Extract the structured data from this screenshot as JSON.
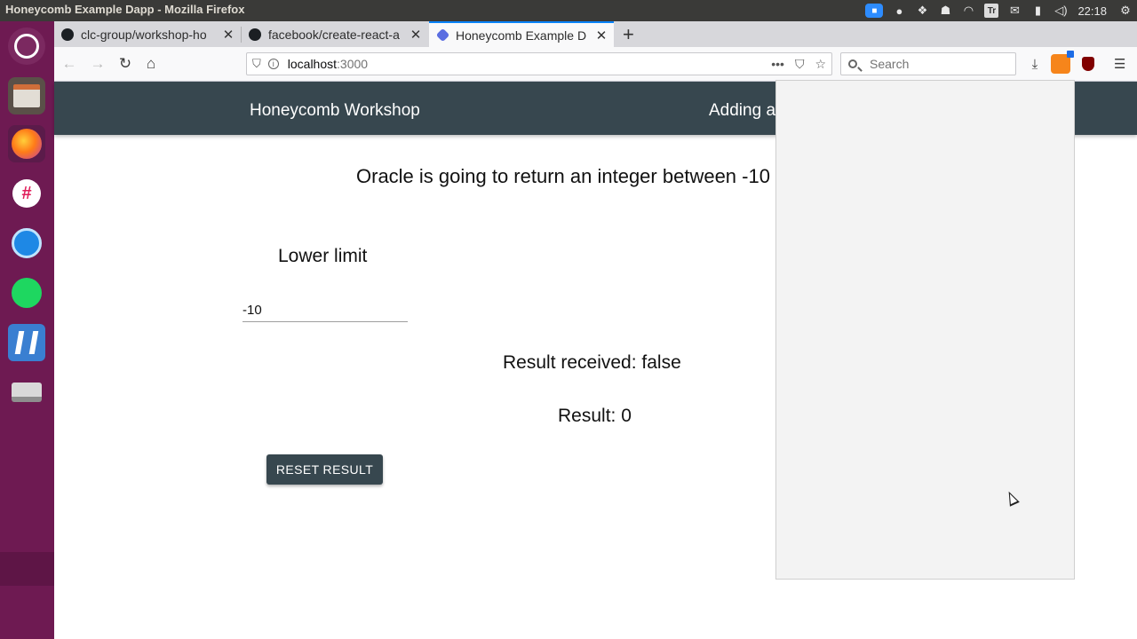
{
  "os": {
    "window_title": "Honeycomb Example Dapp - Mozilla Firefox",
    "clock": "22:18",
    "tray_tr_label": "Tr"
  },
  "launcher": {
    "items": [
      "ubuntu-icon",
      "files-icon",
      "firefox-icon",
      "slack-icon",
      "power-icon",
      "spotify-icon",
      "vscode-icon",
      "disk-icon"
    ]
  },
  "browser": {
    "tabs": [
      {
        "label": "clc-group/workshop-ho",
        "icon": "github-icon"
      },
      {
        "label": "facebook/create-react-a",
        "icon": "github-icon"
      },
      {
        "label": "Honeycomb Example D",
        "icon": "honeycomb-icon",
        "active": true
      }
    ],
    "url": {
      "host": "localhost",
      "port": ":3000"
    },
    "search": {
      "placeholder": "Search"
    }
  },
  "app": {
    "header_title": "Honeycomb Workshop",
    "header_nav": "Adding a",
    "oracle_message": "Oracle is going to return an integer between -10",
    "lower_label": "Lower limit",
    "lower_value": "-10",
    "result_received": "Result received: false",
    "result": "Result: 0",
    "reset_label": "RESET RESULT",
    "accent_color": "#37474f"
  }
}
